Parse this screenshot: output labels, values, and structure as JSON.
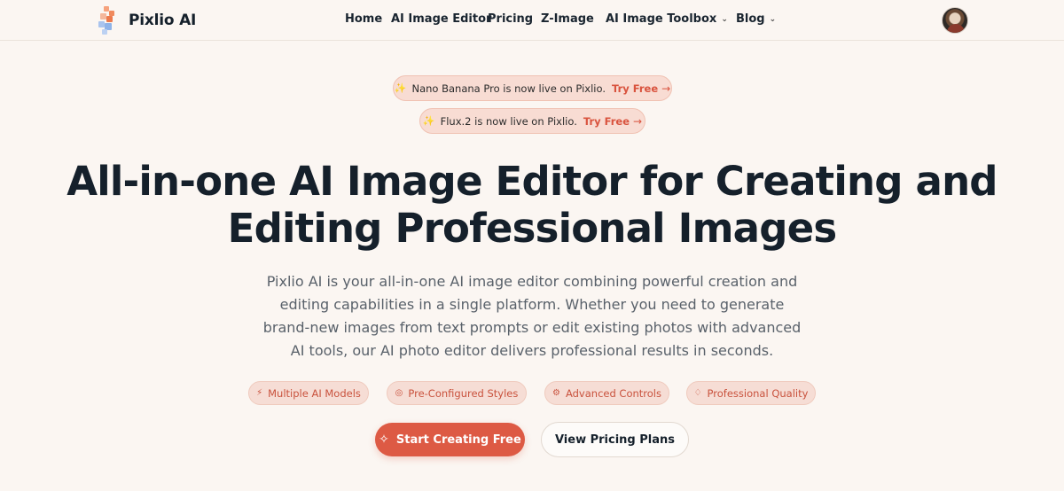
{
  "brand": {
    "name": "Pixlio AI",
    "colors": {
      "accent": "#dd5a44",
      "logo_orange": "#f08a5d",
      "logo_blue": "#8fb3e8"
    }
  },
  "nav": {
    "items": [
      {
        "label": "Home"
      },
      {
        "label": "AI Image Editor"
      },
      {
        "label": "Pricing"
      },
      {
        "label": "Z-Image"
      },
      {
        "label": "AI Image Toolbox",
        "dropdown": true
      },
      {
        "label": "Blog",
        "dropdown": true
      }
    ]
  },
  "user": {
    "avatar_icon": "user-avatar"
  },
  "announcements": [
    {
      "icon": "sparkle-icon",
      "text": "Nano Banana Pro is now live on Pixlio.",
      "cta": "Try Free"
    },
    {
      "icon": "sparkle-icon",
      "text": "Flux.2 is now live on Pixlio.",
      "cta": "Try Free"
    }
  ],
  "hero": {
    "title_line1": "All-in-one AI Image Editor for Creating and",
    "title_line2": "Editing Professional Images",
    "subtitle": "Pixlio AI is your all-in-one AI image editor combining powerful creation and editing capabilities in a single platform. Whether you need to generate brand-new images from text prompts or edit existing photos with advanced AI tools, our AI photo editor delivers professional results in seconds."
  },
  "features": [
    {
      "icon": "lightning-icon",
      "label": "Multiple AI Models"
    },
    {
      "icon": "palette-icon",
      "label": "Pre-Configured Styles"
    },
    {
      "icon": "settings-icon",
      "label": "Advanced Controls"
    },
    {
      "icon": "gem-icon",
      "label": "Professional Quality"
    }
  ],
  "cta": {
    "primary": "Start Creating Free",
    "secondary": "View Pricing Plans"
  }
}
